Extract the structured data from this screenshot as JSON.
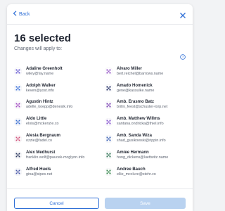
{
  "header": {
    "back_label": "Back",
    "title": "16 selected",
    "subtitle": "Changes will apply to:"
  },
  "people": [
    {
      "name": "Adaline Greenholt",
      "email": "wiley@fay.name",
      "color": "#6b5fd3"
    },
    {
      "name": "Alvaro Miller",
      "email": "bert.reichel@barrows.name",
      "color": "#9b5fc9"
    },
    {
      "name": "Adolph Walker",
      "email": "keven@yost.info",
      "color": "#3f73d8"
    },
    {
      "name": "Amado Homenick",
      "email": "gene@kassulke.name",
      "color": "#2e3a6e"
    },
    {
      "name": "Agustin Hintz",
      "email": "adelle_koepp@denesik.info",
      "color": "#a34fc2"
    },
    {
      "name": "Amb. Erasmo Batz",
      "email": "britni_feest@schuster-torp.net",
      "color": "#7f49b5"
    },
    {
      "name": "Aldo Little",
      "email": "elois@mckenzie.co",
      "color": "#3b6fd0"
    },
    {
      "name": "Amb. Matthew Willms",
      "email": "santana.ondricka@thiel.info",
      "color": "#8a5ad0"
    },
    {
      "name": "Alesia Bergnaum",
      "email": "ozzie@fadel.co",
      "color": "#d0567e"
    },
    {
      "name": "Amb. Sanda Wiza",
      "email": "shad_gusikowski@rippin.info",
      "color": "#4468b8"
    },
    {
      "name": "Alex Medhurst",
      "email": "franklin.wolf@paucek-mcglynn.info",
      "color": "#2f3b61"
    },
    {
      "name": "Amiee Hermann",
      "email": "hong_dickens@luettwitz.name",
      "color": "#3a7a5c"
    },
    {
      "name": "Alfred Huels",
      "email": "gina@sipes.net",
      "color": "#4b5aa8"
    },
    {
      "name": "Andree Bauch",
      "email": "ellie_mcclure@stehr.co",
      "color": "#3f8c56"
    }
  ],
  "footer": {
    "cancel_label": "Cancel",
    "save_label": "Save"
  },
  "colors": {
    "accent": "#2f6fd6",
    "save_disabled": "#b9d2f0"
  },
  "icons": {
    "back": "chevron-left-icon",
    "close": "close-icon",
    "help": "help-icon",
    "avatar": "identicon-avatar"
  }
}
